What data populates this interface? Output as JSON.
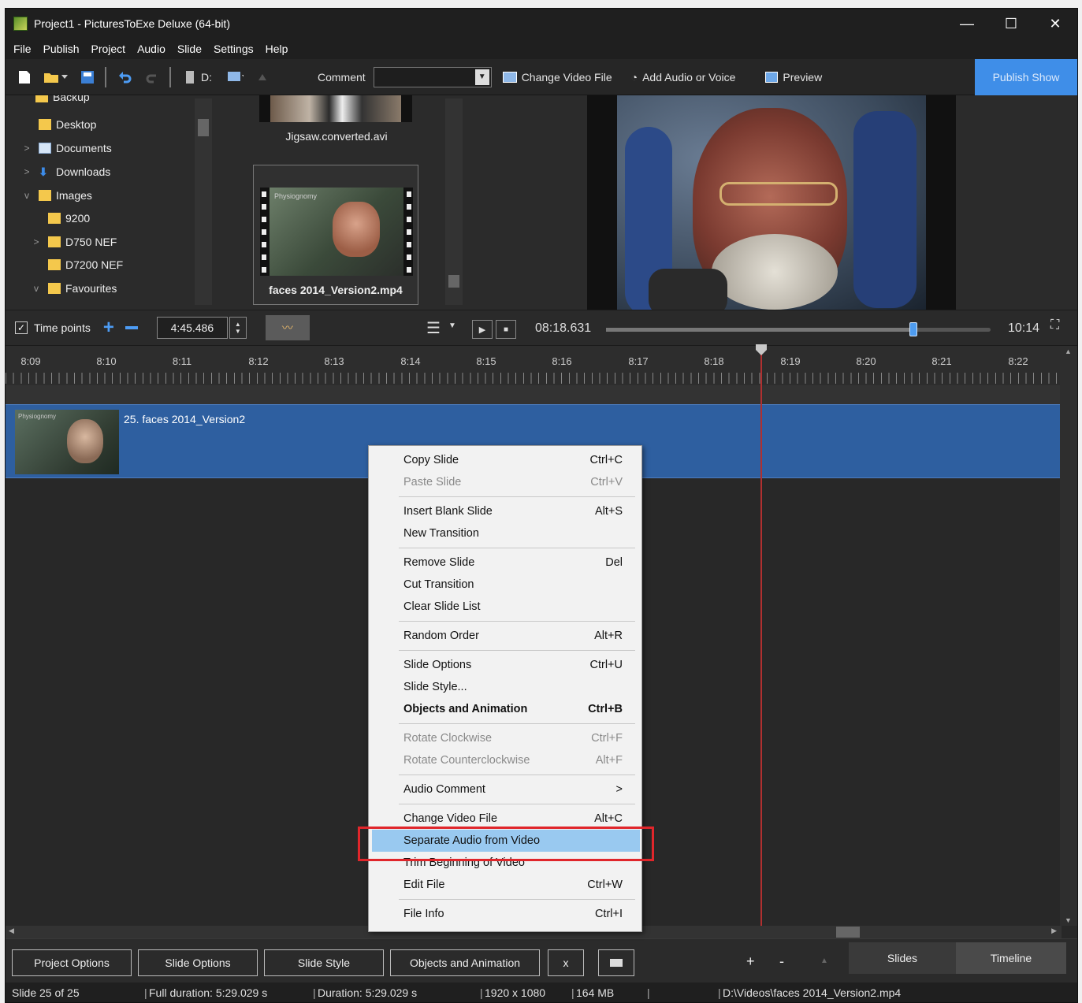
{
  "window": {
    "title": "Project1 - PicturesToExe Deluxe (64-bit)",
    "controls": [
      "—",
      "☐",
      "✕"
    ]
  },
  "menu": [
    "File",
    "Publish",
    "Project",
    "Audio",
    "Slide",
    "Settings",
    "Help"
  ],
  "toolbar": {
    "drive_label": "D:",
    "comment_label": "Comment",
    "comment_value": "",
    "change_video_file": "Change Video File",
    "add_audio": "Add Audio or Voice",
    "preview": "Preview",
    "publish_show": "Publish Show"
  },
  "tree": {
    "items": [
      {
        "label": "Backup",
        "indent": 1,
        "chevron": ""
      },
      {
        "label": "Desktop",
        "indent": 1,
        "chevron": ""
      },
      {
        "label": "Documents",
        "indent": 1,
        "chevron": ">"
      },
      {
        "label": "Downloads",
        "indent": 1,
        "chevron": ">"
      },
      {
        "label": "Images",
        "indent": 1,
        "chevron": "v"
      },
      {
        "label": "9200",
        "indent": 2,
        "chevron": ""
      },
      {
        "label": "D750 NEF",
        "indent": 2,
        "chevron": ">"
      },
      {
        "label": "D7200 NEF",
        "indent": 2,
        "chevron": ""
      },
      {
        "label": "Favourites",
        "indent": 2,
        "chevron": "v"
      }
    ]
  },
  "files": {
    "item1": "Jigsaw.converted.avi",
    "item2": "faces 2014_Version2.mp4",
    "item2_overlay": "Physiognomy"
  },
  "timebar": {
    "time_points_label": "Time points",
    "time_points_checked": true,
    "time_value": "4:45.486",
    "current_time": "08:18.631",
    "total_time": "10:14",
    "seek_position": 0.8
  },
  "ruler": [
    "8:09",
    "8:10",
    "8:11",
    "8:12",
    "8:13",
    "8:14",
    "8:15",
    "8:16",
    "8:17",
    "8:18",
    "8:19",
    "8:20",
    "8:21",
    "8:22"
  ],
  "clip": {
    "label": "25. faces 2014_Version2",
    "thumb_text": "Physiognomy"
  },
  "context_menu": [
    {
      "label": "Copy Slide",
      "key": "Ctrl+C"
    },
    {
      "label": "Paste Slide",
      "key": "Ctrl+V",
      "disabled": true
    },
    {
      "sep": true
    },
    {
      "label": "Insert Blank Slide",
      "key": "Alt+S"
    },
    {
      "label": "New Transition",
      "key": ""
    },
    {
      "sep": true
    },
    {
      "label": "Remove Slide",
      "key": "Del"
    },
    {
      "label": "Cut Transition",
      "key": ""
    },
    {
      "label": "Clear Slide List",
      "key": ""
    },
    {
      "sep": true
    },
    {
      "label": "Random Order",
      "key": "Alt+R"
    },
    {
      "sep": true
    },
    {
      "label": "Slide Options",
      "key": "Ctrl+U"
    },
    {
      "label": "Slide Style...",
      "key": ""
    },
    {
      "label": "Objects and Animation",
      "key": "Ctrl+B",
      "bold": true
    },
    {
      "sep": true
    },
    {
      "label": "Rotate Clockwise",
      "key": "Ctrl+F",
      "disabled": true
    },
    {
      "label": "Rotate Counterclockwise",
      "key": "Alt+F",
      "disabled": true
    },
    {
      "sep": true
    },
    {
      "label": "Audio Comment",
      "key": ">"
    },
    {
      "sep": true
    },
    {
      "label": "Change Video File",
      "key": "Alt+C"
    },
    {
      "label": "Separate Audio from Video",
      "key": "",
      "highlighted": true
    },
    {
      "label": "Trim Beginning of Video",
      "key": ""
    },
    {
      "label": "Edit File",
      "key": "Ctrl+W"
    },
    {
      "sep": true
    },
    {
      "label": "File Info",
      "key": "Ctrl+I"
    }
  ],
  "bottom": {
    "project_options": "Project Options",
    "slide_options": "Slide Options",
    "slide_style": "Slide Style",
    "objects_animation": "Objects and Animation",
    "x": "x",
    "plus": "+",
    "minus": "-",
    "slides_tab": "Slides",
    "timeline_tab": "Timeline"
  },
  "status": {
    "slide": "Slide 25 of 25",
    "full_duration": "Full duration: 5:29.029 s",
    "duration": "Duration: 5:29.029 s",
    "resolution": "1920 x 1080",
    "size": "164 MB",
    "path": "D:\\Videos\\faces 2014_Version2.mp4"
  },
  "colors": {
    "accent": "#3f8ee8",
    "track": "#2e5fa0",
    "playhead": "#b03030",
    "highlight": "#99c9f0",
    "annotation": "#e0262b"
  }
}
